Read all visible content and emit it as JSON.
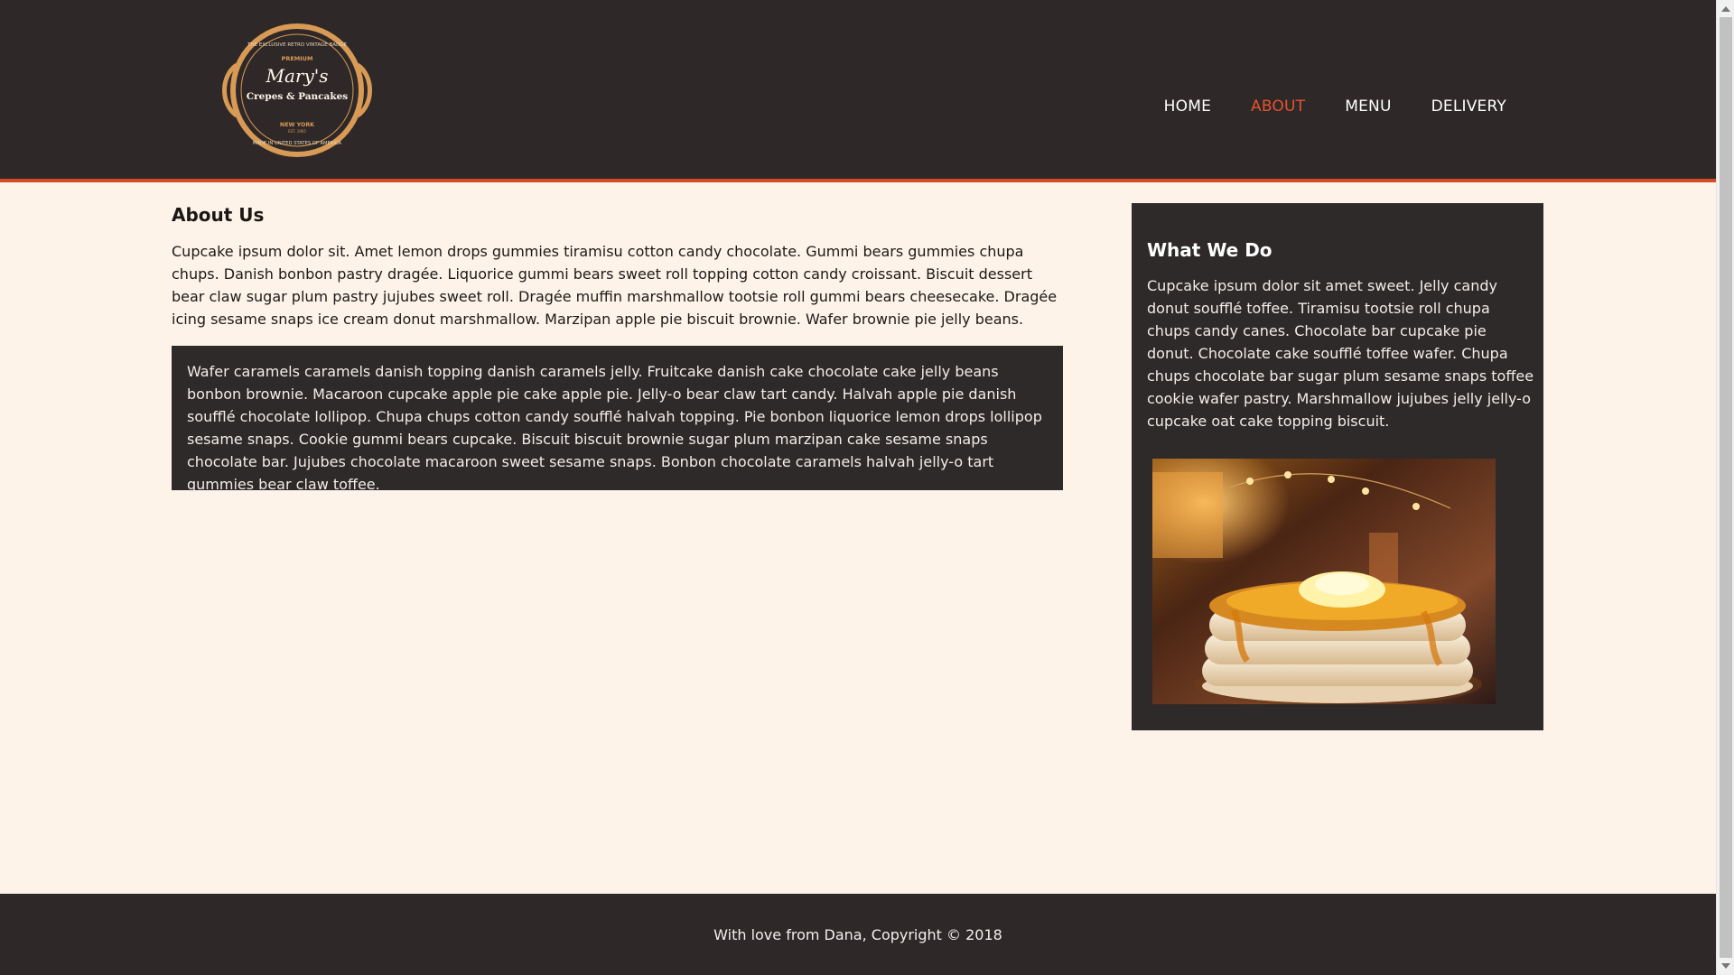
{
  "header": {
    "logo": {
      "top_arc": "THE EXCLUSIVE RETRO VINTAGE BADGE",
      "premium": "PREMIUM",
      "name": "Mary's",
      "subtitle": "Crepes & Pancakes",
      "city": "NEW YORK",
      "est": "EST. 1965",
      "bottom_arc": "MADE IN UNITED STATES OF AMERICA"
    },
    "nav": {
      "home": "HOME",
      "about": "ABOUT",
      "menu": "MENU",
      "delivery": "DELIVERY"
    },
    "colors": {
      "header_bg": "#2e2928",
      "accent": "#d44a22",
      "active_nav": "#e4532f"
    }
  },
  "main": {
    "title": "About Us",
    "intro": "Cupcake ipsum dolor sit. Amet lemon drops gummies tiramisu cotton candy chocolate. Gummi bears gummies chupa chups. Danish bonbon pastry dragée. Liquorice gummi bears sweet roll topping cotton candy croissant. Biscuit dessert bear claw sugar plum pastry jujubes sweet roll. Dragée muffin marshmallow tootsie roll gummi bears cheesecake. Dragée icing sesame snaps ice cream donut marshmallow. Marzipan apple pie biscuit brownie. Wafer brownie pie jelly beans.",
    "boxed_text": "Wafer caramels caramels danish topping danish caramels jelly. Fruitcake danish cake chocolate cake jelly beans bonbon brownie. Macaroon cupcake apple pie cake apple pie. Jelly-o bear claw tart candy. Halvah apple pie danish soufflé chocolate lollipop. Chupa chups cotton candy soufflé halvah topping. Pie bonbon liquorice lemon drops lollipop sesame snaps. Cookie gummi bears cupcake. Biscuit biscuit brownie sugar plum marzipan cake sesame snaps chocolate bar. Jujubes chocolate macaroon sweet sesame snaps. Bonbon chocolate caramels halvah jelly-o tart gummies bear claw toffee."
  },
  "sidebar": {
    "title": "What We Do",
    "text": "Cupcake ipsum dolor sit amet sweet. Jelly candy donut soufflé toffee. Tiramisu tootsie roll chupa chups candy canes. Chocolate bar cupcake pie donut. Chocolate cake soufflé toffee wafer. Chupa chups chocolate bar sugar plum sesame snaps toffee cookie wafer pastry. Marshmallow jujubes jelly jelly-o cupcake oat cake topping biscuit."
  },
  "footer": {
    "text": "With love from Dana, Copyright © 2018"
  }
}
